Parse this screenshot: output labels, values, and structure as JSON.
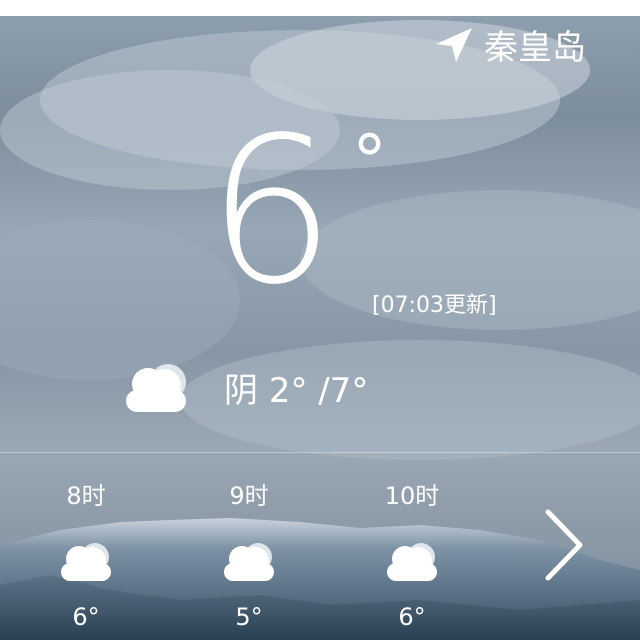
{
  "location": {
    "city": "秦皇岛",
    "icon": "location-arrow-icon"
  },
  "current": {
    "temperature": "6",
    "degree_symbol": "°",
    "updated": "[07:03更新]"
  },
  "today": {
    "condition": "阴",
    "low": "2°",
    "separator": "/",
    "high": "7°",
    "icon": "cloud-icon"
  },
  "hourly": [
    {
      "label": "8时",
      "temp": "6°",
      "icon": "cloud-icon"
    },
    {
      "label": "9时",
      "temp": "5°",
      "icon": "cloud-icon"
    },
    {
      "label": "10时",
      "temp": "6°",
      "icon": "cloud-icon"
    }
  ],
  "nav": {
    "next_icon": "chevron-right-icon"
  },
  "colors": {
    "text": "#ffffff",
    "sky": "#8a9aaa",
    "mountain": "#4e6478"
  }
}
